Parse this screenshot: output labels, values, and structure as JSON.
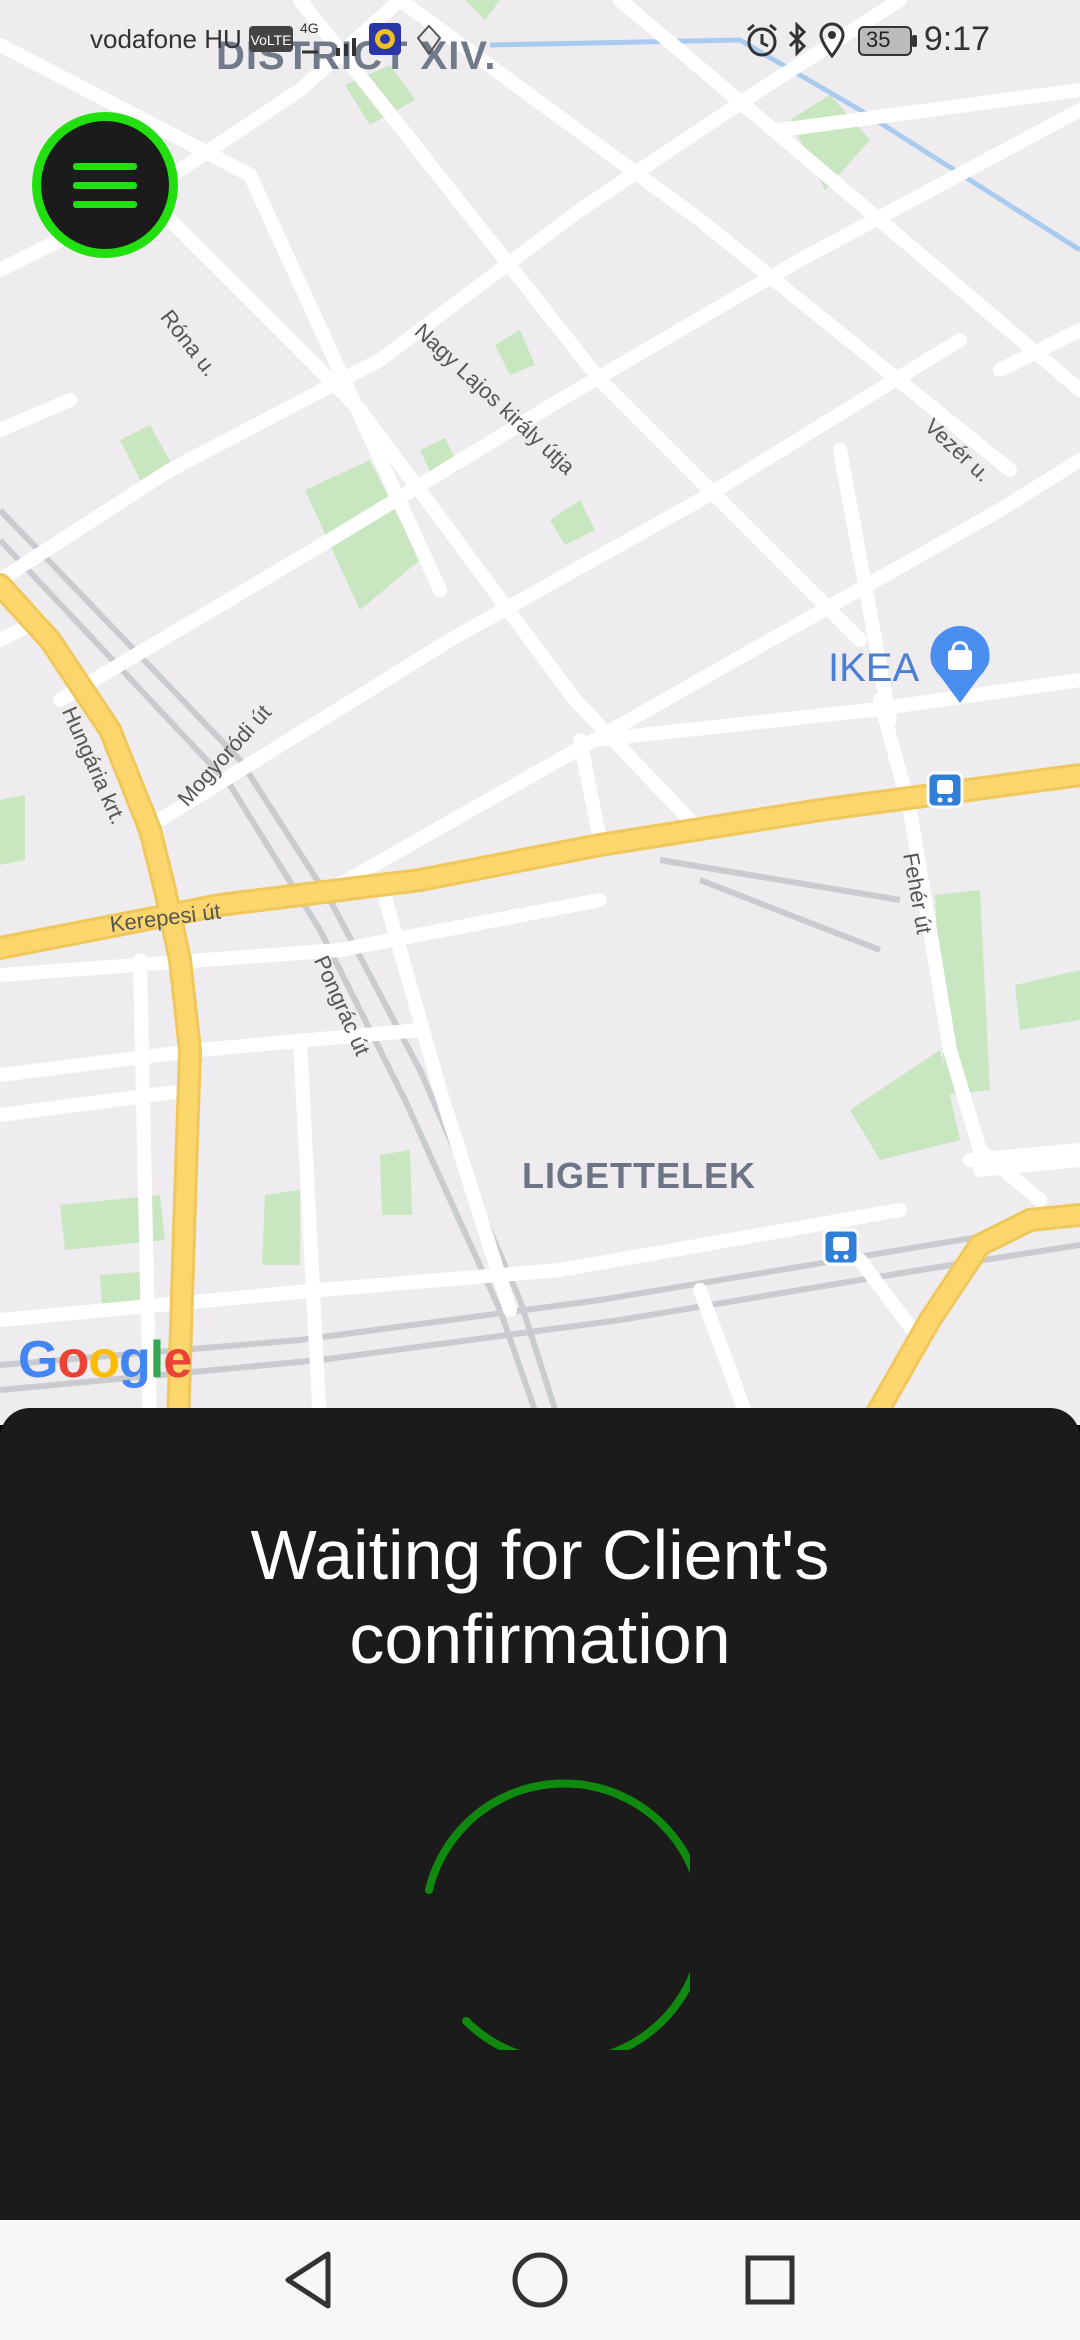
{
  "status_bar": {
    "carrier": "vodafone HU",
    "network": "4G",
    "battery": "35",
    "time": "9:17"
  },
  "map": {
    "labels": {
      "district": "DISTRICT XIV.",
      "rona": "Róna u.",
      "nagy_lajos": "Nagy Lajos király útja",
      "vezer": "Vezér u.",
      "ikea": "IKEA",
      "hungaria": "Hungária krt.",
      "mogyorodi": "Mogyoródi út",
      "kerepesi": "Kerepesi út",
      "feher": "Fehér út",
      "pongrac": "Pongrác út",
      "ligettelek": "LIGETTELEK"
    },
    "google_logo": [
      "G",
      "o",
      "o",
      "g",
      "l",
      "e"
    ],
    "colors": {
      "background": "#efecef",
      "road": "#ffffff",
      "highway": "#fad66d",
      "park": "#c8e6c0",
      "rail": "#c9cbcf"
    }
  },
  "menu_button": {
    "icon": "hamburger-menu-icon",
    "accent": "#22e010"
  },
  "sheet": {
    "title_line1": "Waiting for Client's",
    "title_line2": "confirmation",
    "spinner_color": "#0f8a0f"
  },
  "nav": {
    "back": "back-triangle-icon",
    "home": "home-circle-icon",
    "recents": "recents-square-icon"
  }
}
